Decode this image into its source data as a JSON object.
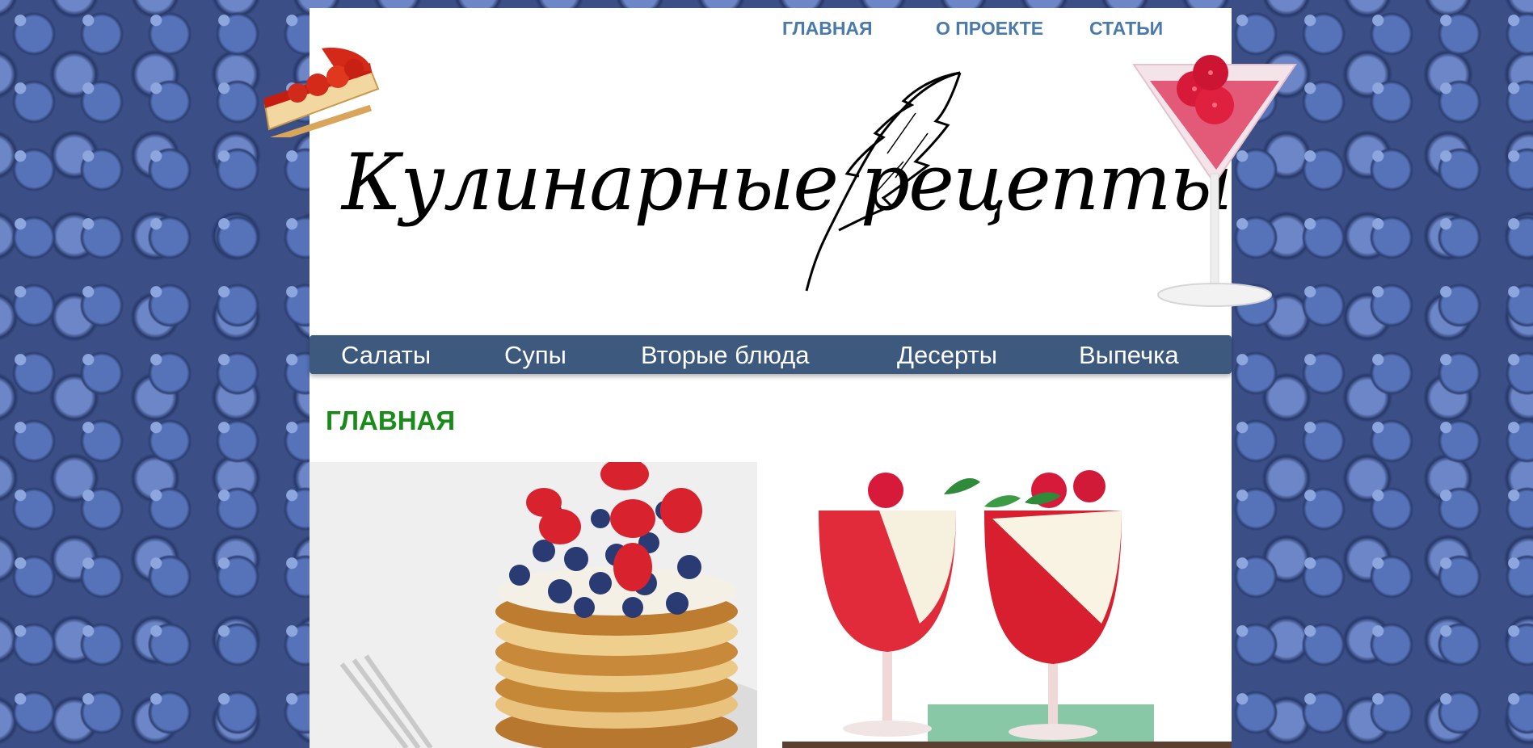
{
  "top_nav": {
    "home": "ГЛАВНАЯ",
    "about": "О ПРОЕКТЕ",
    "articles": "СТАТЬИ"
  },
  "logo": {
    "text": "Кулинарные рецепты"
  },
  "main_nav": {
    "items": [
      "Салаты",
      "Супы",
      "Вторые блюда",
      "Десерты",
      "Выпечка"
    ]
  },
  "content": {
    "heading": "ГЛАВНАЯ"
  },
  "icons": {
    "cake": "cheesecake-slice-icon",
    "cocktail": "raspberry-cocktail-icon",
    "quill": "quill-feather-icon"
  },
  "colors": {
    "nav_bg": "#3d5a7e",
    "top_link": "#4a79ad",
    "heading": "#1a8a1a",
    "background": "#3b4f86"
  }
}
